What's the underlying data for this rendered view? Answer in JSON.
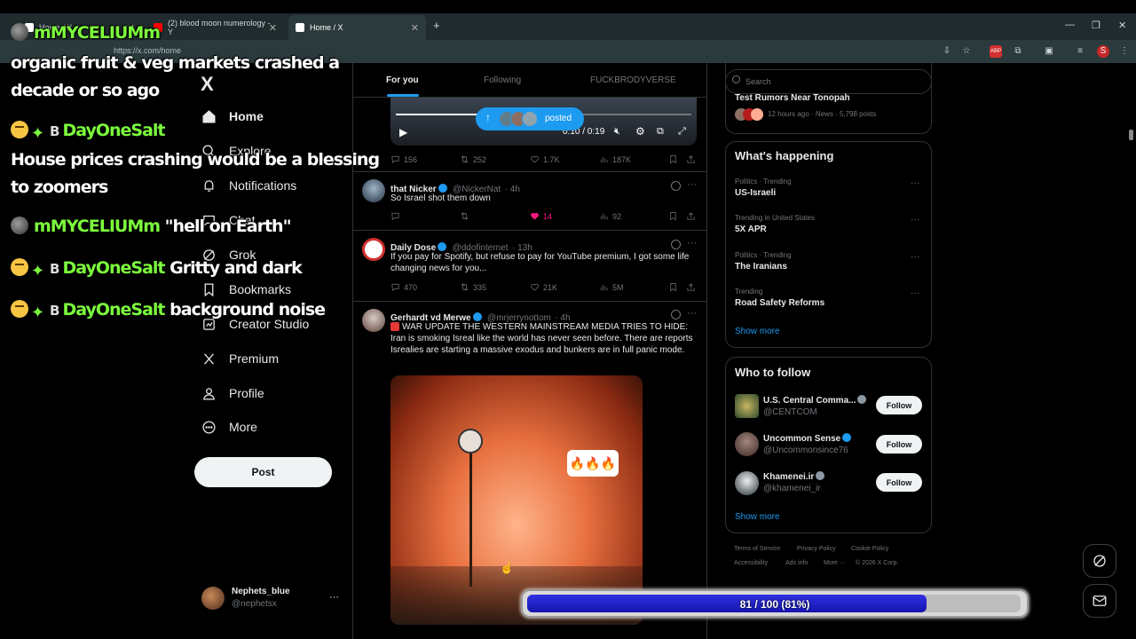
{
  "browser": {
    "tabs": [
      {
        "label": "Home / X"
      },
      {
        "label": "(2) blood moon numerology - Y"
      },
      {
        "label": "Home / X"
      }
    ],
    "url": "https://x.com/home",
    "new_tab": "+"
  },
  "chat_overlay": {
    "lines": [
      {
        "name": "mMYCELIUMm",
        "message": ""
      },
      {
        "name": "",
        "message": "organic fruit & veg markets crashed a"
      },
      {
        "name": "",
        "message": "decade or so ago"
      },
      {
        "name": "DayOneSalt",
        "message": ""
      },
      {
        "name": "",
        "message": "House prices crashing would be a blessing"
      },
      {
        "name": "",
        "message": "to zoomers"
      },
      {
        "name": "mMYCELIUMm",
        "message": "\"hell on Earth\""
      },
      {
        "name": "DayOneSalt",
        "message": "Gritty and dark"
      },
      {
        "name": "DayOneSalt",
        "message": "background noise"
      }
    ],
    "badge_letter": "B"
  },
  "sidebar": {
    "logo": "X",
    "items": [
      {
        "label": "Home",
        "icon": "home-icon"
      },
      {
        "label": "Explore",
        "icon": "search-icon"
      },
      {
        "label": "Notifications",
        "icon": "bell-icon"
      },
      {
        "label": "Chat",
        "icon": "chat-icon"
      },
      {
        "label": "Grok",
        "icon": "grok-icon"
      },
      {
        "label": "Bookmarks",
        "icon": "bookmark-icon"
      },
      {
        "label": "Creator Studio",
        "icon": "creator-studio-icon"
      },
      {
        "label": "Premium",
        "icon": "x-premium-icon"
      },
      {
        "label": "Profile",
        "icon": "profile-icon"
      },
      {
        "label": "More",
        "icon": "more-circle-icon"
      }
    ],
    "post_label": "Post",
    "account": {
      "name": "Nephets_blue",
      "handle": "@nephetsx",
      "more": "···"
    }
  },
  "feed": {
    "tabs": [
      "For you",
      "Following",
      "FUCKBRODYVERSE"
    ],
    "posted_pill": "posted",
    "video": {
      "time": "0:10 / 0:19"
    },
    "first_stats": {
      "replies": "156",
      "reposts": "252",
      "likes": "1.7K",
      "views": "187K"
    },
    "tweets": [
      {
        "name": "that Nicker",
        "handle": "@NickerNat",
        "time": "· 4h",
        "text": "So Israel shot them down",
        "replies": "",
        "reposts": "",
        "likes": "14",
        "views": "92"
      },
      {
        "name": "Daily Dose",
        "handle": "@ddofinternet",
        "time": "· 13h",
        "text": "If you pay for Spotify, but refuse to pay for YouTube premium, I got some life changing news for you...",
        "replies": "470",
        "reposts": "335",
        "likes": "21K",
        "views": "5M"
      },
      {
        "name": "Gerhardt vd Merwe",
        "handle": "@mrjerrynottom",
        "time": "· 4h",
        "text": "WAR UPDATE THE WESTERN MAINSTREAM MEDIA TRIES TO HIDE: Iran is smoking Isreal like the world has never seen before. There are reports Isrealies are starting a massive exodus and bunkers are in full panic mode.",
        "image_caption": "🔥🔥🔥"
      }
    ]
  },
  "right": {
    "search_placeholder": "Search",
    "top_trend": {
      "title": "Test Rumors Near Tonopah",
      "meta": "12 hours ago · News · 5,798 posts"
    },
    "whats_happening": {
      "title": "What's happening",
      "trends": [
        {
          "meta": "Politics · Trending",
          "name": "US-Israeli"
        },
        {
          "meta": "Trending in United States",
          "name": "5X APR"
        },
        {
          "meta": "Politics · Trending",
          "name": "The Iranians"
        },
        {
          "meta": "Trending",
          "name": "Road Safety Reforms"
        }
      ],
      "show_more": "Show more"
    },
    "who_to_follow": {
      "title": "Who to follow",
      "accounts": [
        {
          "name": "U.S. Central Comma...",
          "handle": "@CENTCOM",
          "button": "Follow"
        },
        {
          "name": "Uncommon Sense",
          "handle": "@Uncommonsince76",
          "button": "Follow"
        },
        {
          "name": "Khamenei.ir",
          "handle": "@khamenei_ir",
          "button": "Follow"
        }
      ],
      "show_more": "Show more"
    },
    "footer": {
      "terms": "Terms of Service",
      "privacy": "Privacy Policy",
      "cookie": "Cookie Policy",
      "accessibility": "Accessibility",
      "ads": "Ads info",
      "more": "More ···",
      "copyright": "© 2026 X Corp."
    }
  },
  "progress": {
    "label": "81 / 100 (81%)",
    "value": 0.81
  },
  "colors": {
    "accent": "#1d9bf0",
    "like": "#f91880",
    "chat_name": "#7cfc3c",
    "progress_fill": "#2020d0"
  }
}
